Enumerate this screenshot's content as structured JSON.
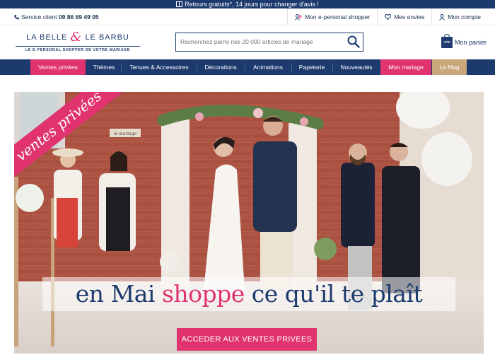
{
  "promo": {
    "text": "Retours gratuits*, 14 jours pour changer d'avis !"
  },
  "utility": {
    "service_label": "Service client",
    "service_phone": "09 86 69 49 05",
    "links": [
      "Mon e-personal shopper",
      "Mes envies",
      "Mon compte"
    ]
  },
  "header": {
    "logo_left": "LA BELLE",
    "logo_amp": "&",
    "logo_right": "LE BARBU",
    "tagline": "LE E-PERSONAL SHOPPER DE VOTRE MARIAGE",
    "search_placeholder": "Recherchez parmi nos 20 000 articles de mariage",
    "cart_badge": "vide",
    "cart_label": "Mon panier"
  },
  "nav": {
    "items": [
      "Ventes privées",
      "Thèmes",
      "Tenues & Accessoires",
      "Décorations",
      "Animations",
      "Papeterie",
      "Nouveautés",
      "Mon mariage",
      "Le Mag"
    ]
  },
  "colors": {
    "navy": "#1c3a6e",
    "pink": "#e0336f",
    "mag": "#c9a77a"
  },
  "hero": {
    "ribbon": "ventes privées",
    "headline_part1": "en Mai ",
    "headline_pink": "shoppe",
    "headline_part2": " ce qu'il te plaît",
    "cta": "ACCEDER AUX VENTES PRIVEES",
    "sign_text": "le mariage"
  }
}
